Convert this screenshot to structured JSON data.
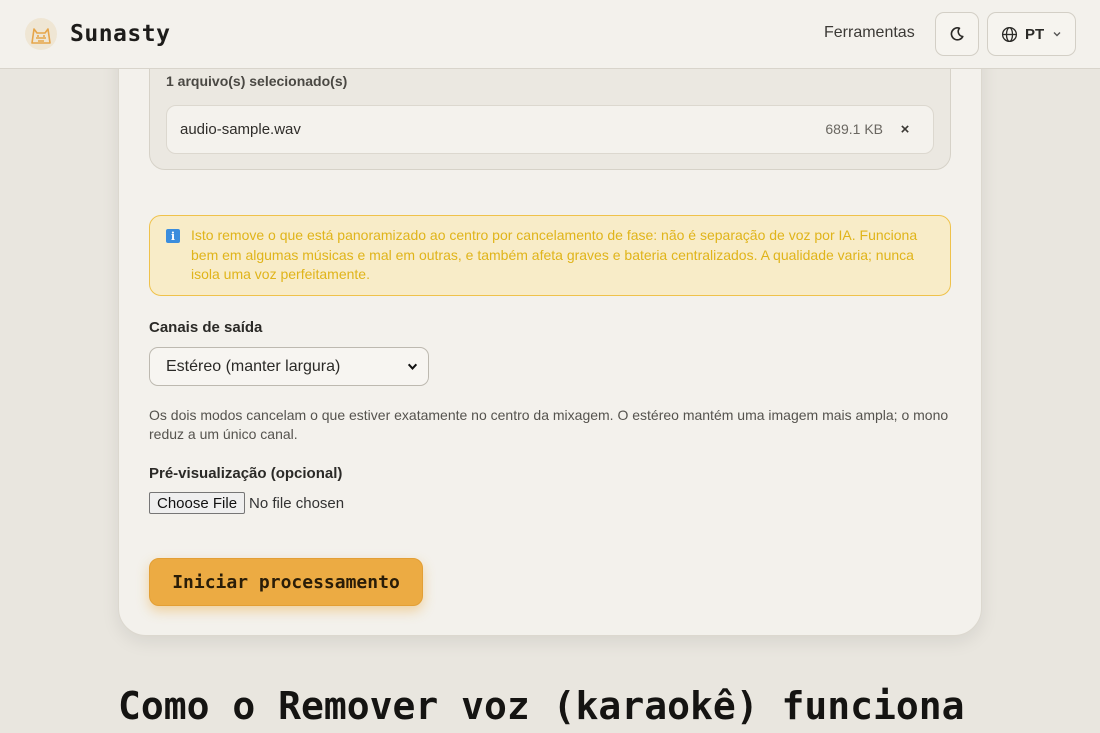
{
  "header": {
    "brand": "Sunasty",
    "nav_tools": "Ferramentas",
    "language": "PT"
  },
  "files": {
    "count_label": "1 arquivo(s) selecionado(s)",
    "items": [
      {
        "name": "audio-sample.wav",
        "size": "689.1 KB",
        "remove": "×"
      }
    ]
  },
  "notice": {
    "icon": "info-icon",
    "text": "Isto remove o que está panoramizado ao centro por cancelamento de fase: não é separação de voz por IA. Funciona bem em algumas músicas e mal em outras, e também afeta graves e bateria centralizados. A qualidade varia; nunca isola uma voz perfeitamente."
  },
  "output_channels": {
    "label": "Canais de saída",
    "selected": "Estéreo (manter largura)",
    "help": "Os dois modos cancelam o que estiver exatamente no centro da mixagem. O estéreo mantém uma imagem mais ampla; o mono reduz a um único canal."
  },
  "preview": {
    "label": "Pré-visualização (opcional)",
    "button": "Choose File",
    "status": "No file chosen"
  },
  "actions": {
    "start": "Iniciar processamento"
  },
  "section": {
    "heading": "Como o Remover voz (karaokê) funciona"
  },
  "colors": {
    "accent": "#ecab43",
    "notice_bg": "#f8ecc8",
    "notice_border": "#efc24b",
    "notice_text": "#e0b41a"
  }
}
